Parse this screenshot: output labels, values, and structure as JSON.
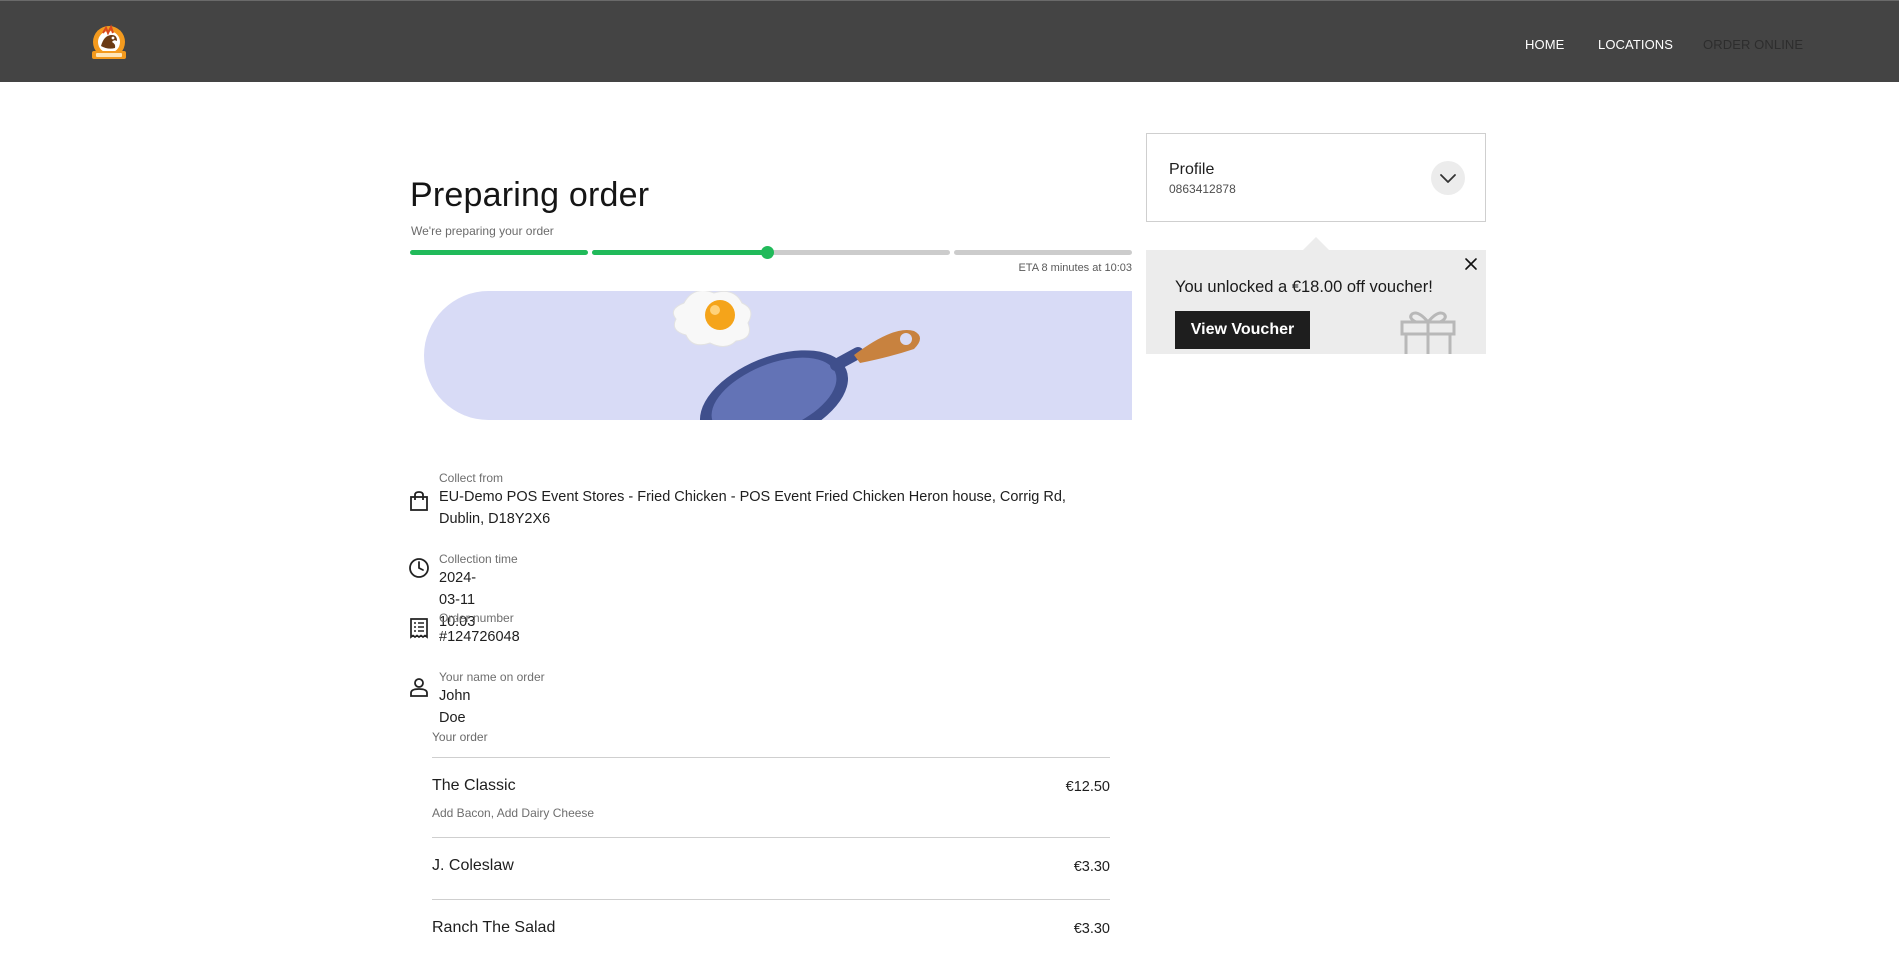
{
  "header": {
    "logo_icon": "chicken-logo-icon",
    "nav": [
      "HOME",
      "LOCATIONS",
      "ORDER ONLINE"
    ]
  },
  "status": {
    "title": "Preparing order",
    "subtitle": "We're preparing your order",
    "eta": "ETA 8 minutes at 10:03",
    "progress": {
      "steps_total": 3,
      "steps_complete": 1,
      "current_step_fraction": 0.98
    },
    "colors": {
      "done": "#21ba5a",
      "pending": "#cccccc",
      "banner": "#d8dbf6"
    }
  },
  "details": {
    "collect": {
      "label": "Collect from",
      "value_line1": "EU-Demo POS Event Stores - Fried Chicken - POS Event Fried Chicken Heron house, Corrig Rd,",
      "value_line2": "Dublin, D18Y2X6",
      "icon": "shopping-bag-icon"
    },
    "time": {
      "label": "Collection time",
      "value": "2024-03-11 10:03",
      "icon": "clock-icon"
    },
    "number": {
      "label": "Order number",
      "value": "#124726048",
      "icon": "receipt-icon"
    },
    "name": {
      "label": "Your name on order",
      "value": "John Doe",
      "icon": "person-icon"
    }
  },
  "order": {
    "heading": "Your order",
    "items": [
      {
        "name": "The Classic",
        "price": "€12.50",
        "mods": "Add Bacon, Add Dairy Cheese"
      },
      {
        "name": "J. Coleslaw",
        "price": "€3.30",
        "mods": ""
      },
      {
        "name": "Ranch The Salad",
        "price": "€3.30",
        "mods": ""
      }
    ]
  },
  "profile": {
    "title": "Profile",
    "phone": "0863412878"
  },
  "voucher": {
    "message": "You unlocked a €18.00 off voucher!",
    "button": "View Voucher"
  }
}
